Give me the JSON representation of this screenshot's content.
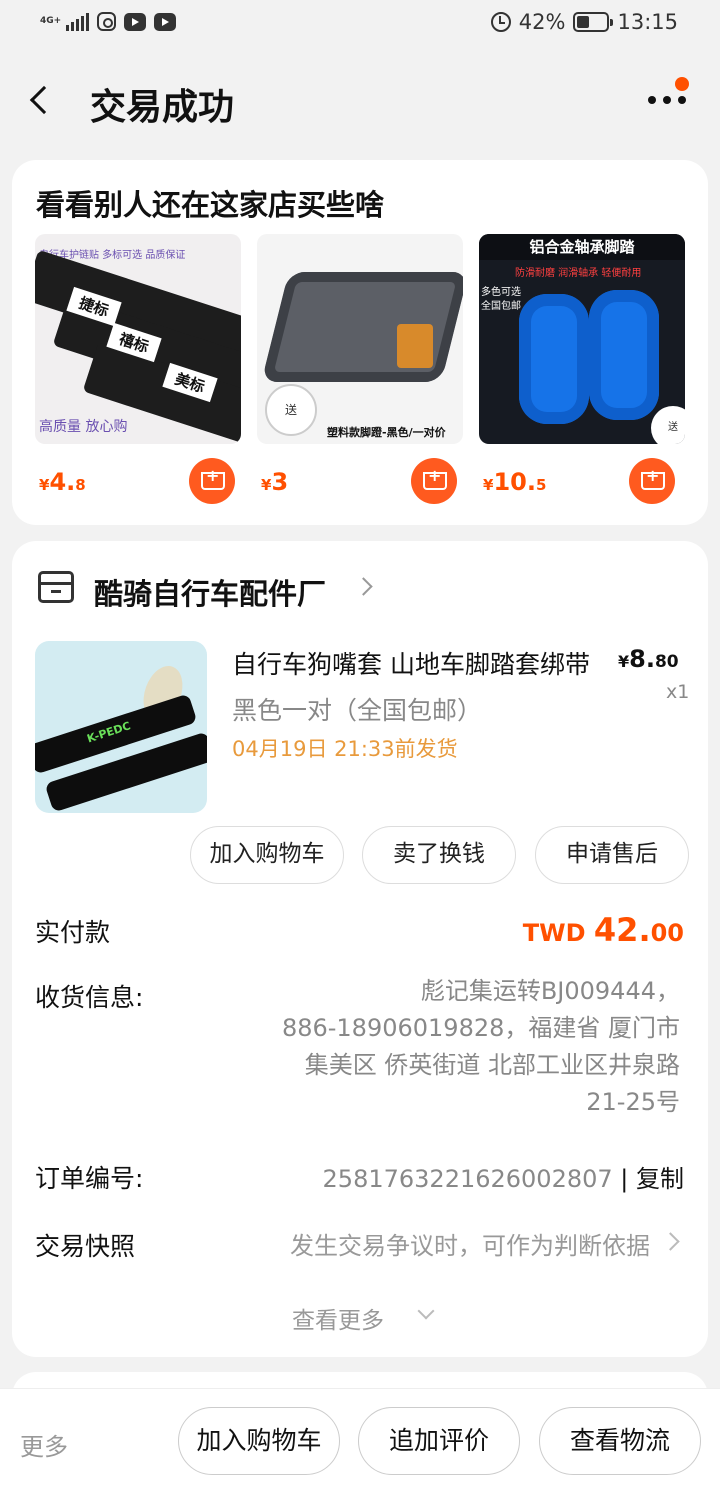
{
  "status_bar": {
    "network": "4G+",
    "battery_text": "42%",
    "battery_level": 0.42,
    "time": "13:15"
  },
  "header": {
    "title": "交易成功",
    "back_icon": "chevron-left-icon",
    "more_icon": "more-dots-icon",
    "accent": "#ff5000"
  },
  "recommend": {
    "title": "看看别人还在这家店买些啥",
    "items": [
      {
        "price_symbol": "¥",
        "price_int": "4.",
        "price_dec": "8",
        "image_text": {
          "cap_top": "自行车护链贴 多标可选 品质保证",
          "tags": [
            "捷标",
            "禧标",
            "美标"
          ],
          "cap_bottom": "高质量 放心购"
        }
      },
      {
        "price_symbol": "¥",
        "price_int": "3",
        "price_dec": "",
        "image_text": {
          "badge": "送",
          "caption": "塑料款脚蹬-黑色/一对价"
        }
      },
      {
        "price_symbol": "¥",
        "price_int": "10.",
        "price_dec": "5",
        "image_text": {
          "header": "铝合金轴承脚踏",
          "sub": "防滑耐磨 润滑轴承 轻便耐用",
          "side": "多色可选 全国包邮",
          "badge": "送"
        }
      }
    ]
  },
  "order": {
    "shop_name": "酷骑自行车配件厂",
    "product": {
      "title": "自行车狗嘴套 山地车脚踏套绑带",
      "price_symbol": "¥",
      "price_int": "8.",
      "price_dec": "80",
      "quantity": "x1",
      "spec": "黑色一对（全国包邮）",
      "ship_by": "04月19日 21:33前发货",
      "image_label": "K-PEDC"
    },
    "actions": [
      "加入购物车",
      "卖了换钱",
      "申请售后"
    ],
    "paid_label": "实付款",
    "paid_currency": "TWD ",
    "paid_int": "42.",
    "paid_dec": "00",
    "address_label": "收货信息:",
    "address_lines": [
      "彪记集运转BJ009444，",
      "886-18906019828，福建省 厦门市",
      "集美区 侨英街道 北部工业区井泉路",
      "21-25号"
    ],
    "order_no_label": "订单编号:",
    "order_no": "2581763221626002807",
    "order_no_sep": " | ",
    "copy_label": "复制",
    "snapshot_label": "交易快照",
    "snapshot_text": "发生交易争议时，可作为判断依据",
    "see_more": "查看更多"
  },
  "bottom_bar": {
    "more_label": "更多",
    "buttons": [
      "加入购物车",
      "追加评价",
      "查看物流"
    ]
  }
}
